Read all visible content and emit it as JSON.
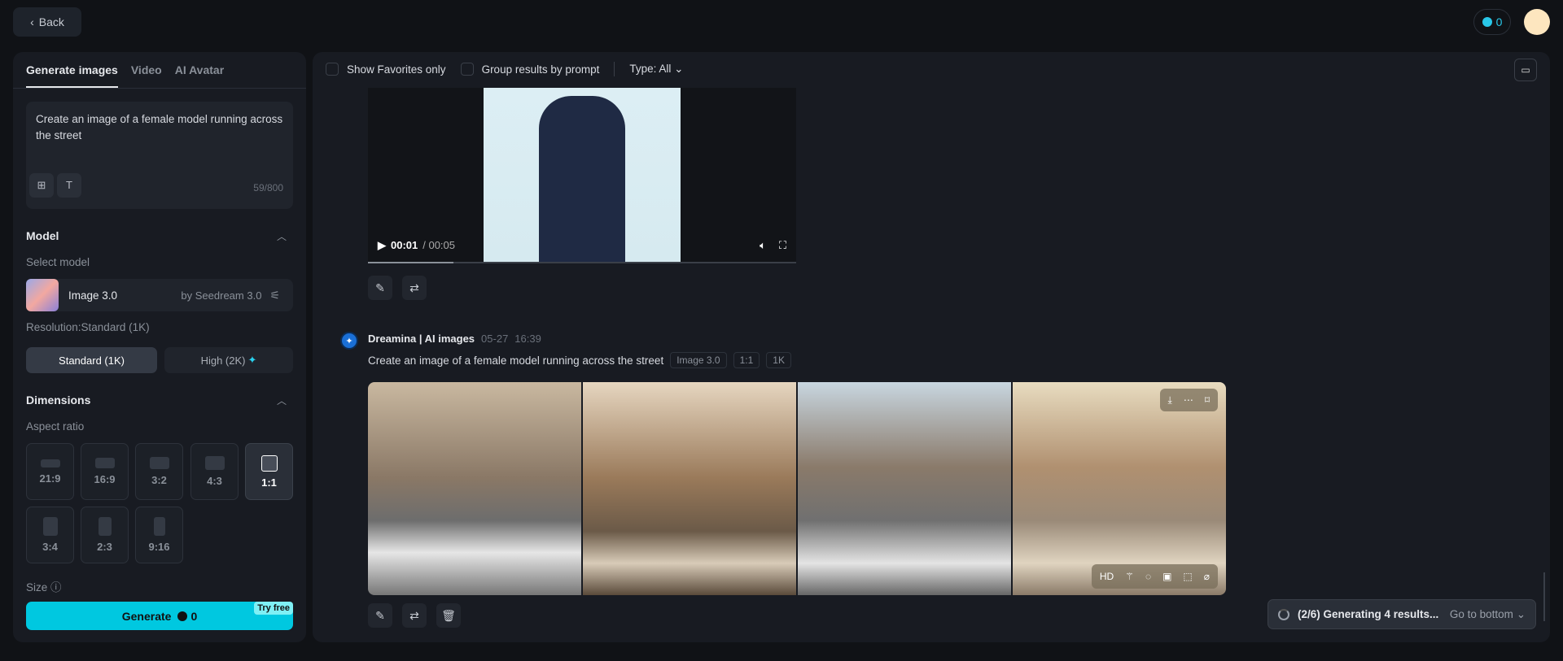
{
  "header": {
    "back_label": "Back",
    "credits": "0"
  },
  "sidebar": {
    "tabs": [
      "Generate images",
      "Video",
      "AI Avatar"
    ],
    "prompt": "Create an image of a female model running across the street",
    "char_count": "59/800",
    "model_section": "Model",
    "select_model_label": "Select model",
    "model_name": "Image 3.0",
    "model_by": "by Seedream 3.0",
    "resolution_label": "Resolution:Standard (1K)",
    "resolution_options": [
      "Standard (1K)",
      "High (2K)"
    ],
    "dimensions_section": "Dimensions",
    "aspect_ratio_label": "Aspect ratio",
    "aspect_ratios": [
      "21:9",
      "16:9",
      "3:2",
      "4:3",
      "1:1",
      "3:4",
      "2:3",
      "9:16"
    ],
    "selected_ratio": "1:1",
    "size_label": "Size",
    "generate_label": "Generate",
    "generate_cost": "0",
    "try_free": "Try free"
  },
  "main": {
    "toolbar": {
      "favorites": "Show Favorites only",
      "group": "Group results by prompt",
      "type": "Type: All"
    },
    "video": {
      "current": "00:01",
      "duration": "/ 00:05",
      "progress": 0.2
    },
    "result": {
      "source": "Dreamina | AI images",
      "date": "05-27",
      "time": "16:39",
      "prompt": "Create an image of a female model running across the street",
      "chips": [
        "Image 3.0",
        "1:1",
        "1K"
      ],
      "hd": "HD"
    },
    "toast": {
      "status": "(2/6) Generating 4 results...",
      "action": "Go to bottom"
    }
  }
}
